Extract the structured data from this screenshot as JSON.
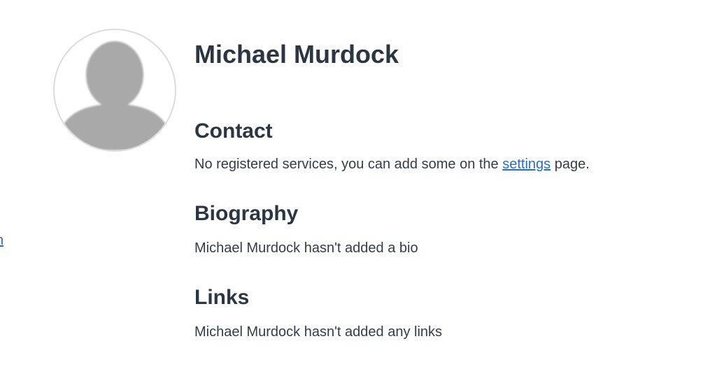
{
  "left_edge_link": "n",
  "profile": {
    "name": "Michael Murdock",
    "avatar_icon": "default-user-silhouette-icon"
  },
  "contact": {
    "title": "Contact",
    "text_before": "No registered services, you can add some on the ",
    "link_label": "settings",
    "text_after": " page."
  },
  "biography": {
    "title": "Biography",
    "text": "Michael Murdock hasn't added a bio"
  },
  "links": {
    "title": "Links",
    "text": "Michael Murdock hasn't added any links"
  },
  "colors": {
    "heading": "#2c3642",
    "link": "#2a6eb8",
    "avatar_fill": "#a9a9a9",
    "avatar_border": "#dcdcdc"
  }
}
